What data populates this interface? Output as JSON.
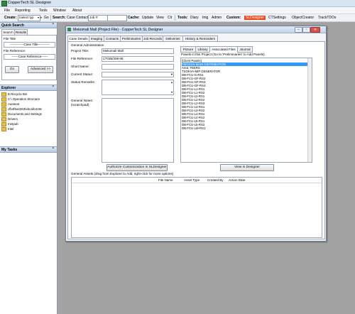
{
  "app": {
    "title": "CopperTech SL Designer"
  },
  "menu": [
    "File",
    "Reporting",
    "Tools",
    "Window",
    "About"
  ],
  "toolbar": {
    "create_label": "Create:",
    "create_value": "(select typ",
    "go_label": "Go",
    "search_label": "Search:",
    "case_label": "Case",
    "contact_label": "Contact",
    "job_placeholder": "Job #:",
    "cache_label": "Cache:",
    "update_label": "Update",
    "view_label": "View",
    "clr_label": "Clr",
    "tools_label": "Tools:",
    "diary_label": "Diary",
    "img_label": "Img",
    "admin_label": "Admin",
    "custom_label": "Custom:",
    "sldesigner_label": "SLDesigner",
    "ctsettings_label": "CTSettings",
    "objectcreator_label": "ObjectCreator",
    "tracktodo_label": "TrackTDOs"
  },
  "left": {
    "quick_search": {
      "header": "Quick Search",
      "tabs": [
        "Search",
        "Results"
      ],
      "file_title_label": "File Title",
      "case_title_placeholder": "-------------Case Title-----------",
      "file_reference_label": "File Reference:",
      "case_reference_placeholder": "------Case Reference------",
      "go_button": "Go",
      "advanced_button": "Advanced >>"
    },
    "explorer": {
      "header": "Explorer",
      "items": [
        "B Recycle Bin",
        "C:\\ Operation Structure",
        "Autotext",
        "cfb4f6a4263\\ebca\\b419c",
        "Documents and Settings",
        "Drivers",
        "Inetpub",
        "Intel"
      ]
    },
    "my_tasks": {
      "header": "My Tasks"
    }
  },
  "window": {
    "title": "Mekomali Mall (Project File) - CopperTech SL Designer",
    "tabs": [
      "Case Details",
      "Imaging",
      "Contacts",
      "Preliminaries",
      "Job Records",
      "Deliveries",
      "History & Reminders"
    ],
    "general_admin_label": "General Administration",
    "fields": {
      "project_title_label": "Project Title:",
      "project_title_value": "Mekomali Mall",
      "file_reference_label": "File Reference:",
      "file_reference_value": "CT/SB/308-08",
      "short_name_label": "Short Name:",
      "short_name_value": "",
      "current_status_label": "Current Status:",
      "current_status_value": "",
      "status_remarks_label": "Status Remarks:",
      "general_notes_label": "General Notes:\n(scratchpad)"
    },
    "authorize_button": "Authorize Customization in SLDesigner",
    "right_tabs": [
      "Picture",
      "Library",
      "Associated Files",
      "Journal"
    ],
    "right_tab_active": 2,
    "panels_caption": "Panels in this Project (Go to 'Preliminaries' to Add Panels)",
    "panel_items": [
      "[Client Panels]",
      "TMOXXX-MAIN DISTRIBUTION",
      "Area: FEERS",
      "TSOKVA-MIP GENERATOR",
      "DB-FCU-G-RS1",
      "DB-FCU-GF-RS2",
      "DB-FCU-GF-RS3",
      "DB-FCU-GF-RS4",
      "DB-FCU-L1-RS1",
      "DB-FCU-L1-RS2",
      "DB-FCU-L2-RS1",
      "DB-FCU-L2-RS2",
      "DB-FCU-L2-RS3",
      "DB-FCU-L3-RS1",
      "DB-FCU-L3-RS2",
      "DB-FCU-L4-RS1",
      "DB-FCU-L4-RS2",
      "DB-FCU-L5-RS1",
      "DB-FCU-L5-RS2",
      "DB-FCU-LM-RS1"
    ],
    "selected_panel_index": 1,
    "view_in_designer_button": "View in Designer",
    "general_assets_caption": "General Assets (drag from Explorer to Add, right-click for more options)",
    "asset_columns": [
      "File Name",
      "Asset Type",
      "Created By",
      "Action Date"
    ]
  },
  "colors": {
    "accent": "#e8481c",
    "selection": "#3399ff",
    "workarea": "#a3a3a3"
  }
}
